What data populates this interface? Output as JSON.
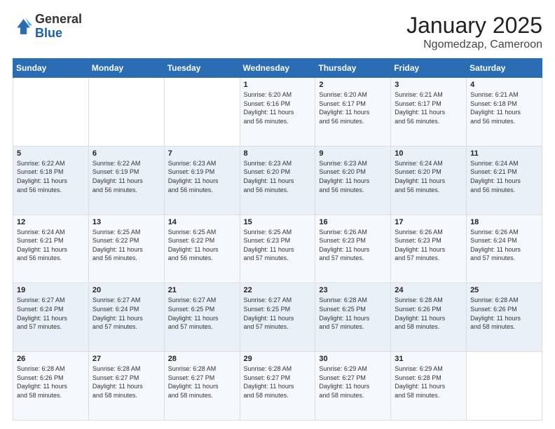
{
  "header": {
    "logo_general": "General",
    "logo_blue": "Blue",
    "title": "January 2025",
    "subtitle": "Ngomedzap, Cameroon"
  },
  "calendar": {
    "days_of_week": [
      "Sunday",
      "Monday",
      "Tuesday",
      "Wednesday",
      "Thursday",
      "Friday",
      "Saturday"
    ],
    "weeks": [
      [
        {
          "day": "",
          "info": ""
        },
        {
          "day": "",
          "info": ""
        },
        {
          "day": "",
          "info": ""
        },
        {
          "day": "1",
          "info": "Sunrise: 6:20 AM\nSunset: 6:16 PM\nDaylight: 11 hours\nand 56 minutes."
        },
        {
          "day": "2",
          "info": "Sunrise: 6:20 AM\nSunset: 6:17 PM\nDaylight: 11 hours\nand 56 minutes."
        },
        {
          "day": "3",
          "info": "Sunrise: 6:21 AM\nSunset: 6:17 PM\nDaylight: 11 hours\nand 56 minutes."
        },
        {
          "day": "4",
          "info": "Sunrise: 6:21 AM\nSunset: 6:18 PM\nDaylight: 11 hours\nand 56 minutes."
        }
      ],
      [
        {
          "day": "5",
          "info": "Sunrise: 6:22 AM\nSunset: 6:18 PM\nDaylight: 11 hours\nand 56 minutes."
        },
        {
          "day": "6",
          "info": "Sunrise: 6:22 AM\nSunset: 6:19 PM\nDaylight: 11 hours\nand 56 minutes."
        },
        {
          "day": "7",
          "info": "Sunrise: 6:23 AM\nSunset: 6:19 PM\nDaylight: 11 hours\nand 56 minutes."
        },
        {
          "day": "8",
          "info": "Sunrise: 6:23 AM\nSunset: 6:20 PM\nDaylight: 11 hours\nand 56 minutes."
        },
        {
          "day": "9",
          "info": "Sunrise: 6:23 AM\nSunset: 6:20 PM\nDaylight: 11 hours\nand 56 minutes."
        },
        {
          "day": "10",
          "info": "Sunrise: 6:24 AM\nSunset: 6:20 PM\nDaylight: 11 hours\nand 56 minutes."
        },
        {
          "day": "11",
          "info": "Sunrise: 6:24 AM\nSunset: 6:21 PM\nDaylight: 11 hours\nand 56 minutes."
        }
      ],
      [
        {
          "day": "12",
          "info": "Sunrise: 6:24 AM\nSunset: 6:21 PM\nDaylight: 11 hours\nand 56 minutes."
        },
        {
          "day": "13",
          "info": "Sunrise: 6:25 AM\nSunset: 6:22 PM\nDaylight: 11 hours\nand 56 minutes."
        },
        {
          "day": "14",
          "info": "Sunrise: 6:25 AM\nSunset: 6:22 PM\nDaylight: 11 hours\nand 56 minutes."
        },
        {
          "day": "15",
          "info": "Sunrise: 6:25 AM\nSunset: 6:23 PM\nDaylight: 11 hours\nand 57 minutes."
        },
        {
          "day": "16",
          "info": "Sunrise: 6:26 AM\nSunset: 6:23 PM\nDaylight: 11 hours\nand 57 minutes."
        },
        {
          "day": "17",
          "info": "Sunrise: 6:26 AM\nSunset: 6:23 PM\nDaylight: 11 hours\nand 57 minutes."
        },
        {
          "day": "18",
          "info": "Sunrise: 6:26 AM\nSunset: 6:24 PM\nDaylight: 11 hours\nand 57 minutes."
        }
      ],
      [
        {
          "day": "19",
          "info": "Sunrise: 6:27 AM\nSunset: 6:24 PM\nDaylight: 11 hours\nand 57 minutes."
        },
        {
          "day": "20",
          "info": "Sunrise: 6:27 AM\nSunset: 6:24 PM\nDaylight: 11 hours\nand 57 minutes."
        },
        {
          "day": "21",
          "info": "Sunrise: 6:27 AM\nSunset: 6:25 PM\nDaylight: 11 hours\nand 57 minutes."
        },
        {
          "day": "22",
          "info": "Sunrise: 6:27 AM\nSunset: 6:25 PM\nDaylight: 11 hours\nand 57 minutes."
        },
        {
          "day": "23",
          "info": "Sunrise: 6:28 AM\nSunset: 6:25 PM\nDaylight: 11 hours\nand 57 minutes."
        },
        {
          "day": "24",
          "info": "Sunrise: 6:28 AM\nSunset: 6:26 PM\nDaylight: 11 hours\nand 58 minutes."
        },
        {
          "day": "25",
          "info": "Sunrise: 6:28 AM\nSunset: 6:26 PM\nDaylight: 11 hours\nand 58 minutes."
        }
      ],
      [
        {
          "day": "26",
          "info": "Sunrise: 6:28 AM\nSunset: 6:26 PM\nDaylight: 11 hours\nand 58 minutes."
        },
        {
          "day": "27",
          "info": "Sunrise: 6:28 AM\nSunset: 6:27 PM\nDaylight: 11 hours\nand 58 minutes."
        },
        {
          "day": "28",
          "info": "Sunrise: 6:28 AM\nSunset: 6:27 PM\nDaylight: 11 hours\nand 58 minutes."
        },
        {
          "day": "29",
          "info": "Sunrise: 6:28 AM\nSunset: 6:27 PM\nDaylight: 11 hours\nand 58 minutes."
        },
        {
          "day": "30",
          "info": "Sunrise: 6:29 AM\nSunset: 6:27 PM\nDaylight: 11 hours\nand 58 minutes."
        },
        {
          "day": "31",
          "info": "Sunrise: 6:29 AM\nSunset: 6:28 PM\nDaylight: 11 hours\nand 58 minutes."
        },
        {
          "day": "",
          "info": ""
        }
      ]
    ]
  }
}
